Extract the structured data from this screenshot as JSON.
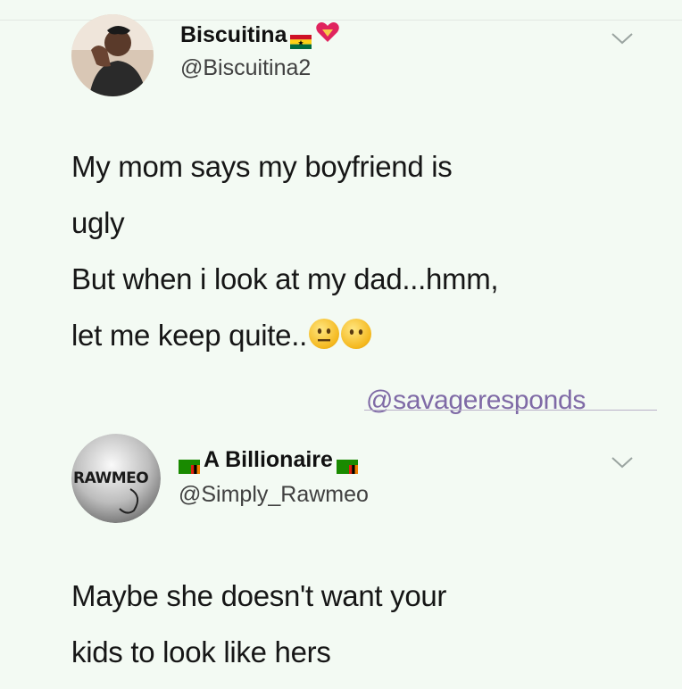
{
  "tweets": [
    {
      "display_name": "Biscuitina",
      "handle": "@Biscuitina2",
      "name_icons": [
        "ghana-flag-icon",
        "heart-icon"
      ],
      "lines": [
        "My mom says my boyfriend is",
        "ugly",
        "But when i look at my dad...hmm,",
        "let me keep quite.."
      ],
      "emojis": [
        "neutral-face-icon",
        "face-without-mouth-icon"
      ]
    },
    {
      "display_name": "A Billionaire",
      "handle": "@Simply_Rawmeo",
      "name_icons": [
        "zambia-flag-icon",
        "zambia-flag-icon"
      ],
      "avatar_text": "RAWMEO",
      "lines": [
        "Maybe she doesn't want your",
        "kids to look like hers"
      ]
    }
  ],
  "watermark": "@savageresponds",
  "colors": {
    "background": "#f3faf3",
    "watermark": "#7f6aa6",
    "handle": "#404040"
  }
}
